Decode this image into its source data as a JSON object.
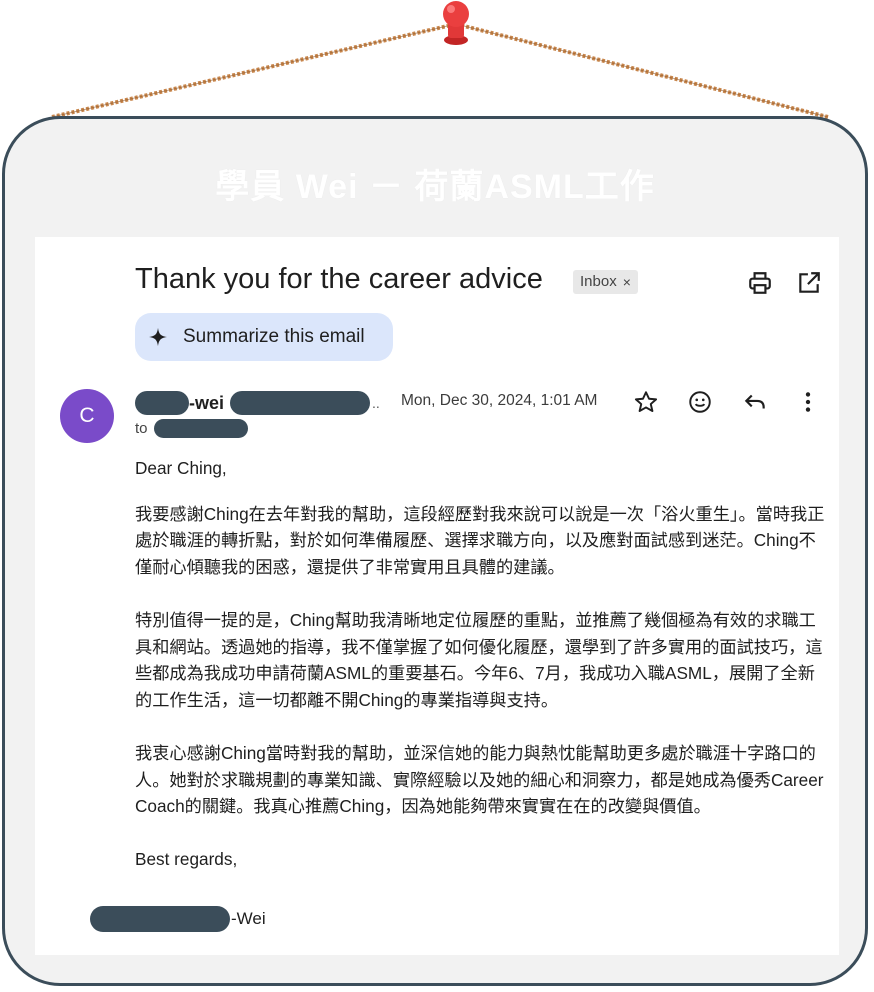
{
  "card": {
    "title": "學員 Wei － 荷蘭ASML工作"
  },
  "email": {
    "subject": "Thank you for the career advice",
    "label": "Inbox",
    "label_close": "×",
    "summarize_label": "Summarize this email",
    "avatar_letter": "C",
    "sender_visible": "-wei",
    "sender_ellipsis": "..",
    "to_prefix": "to",
    "date": "Mon, Dec 30, 2024, 1:01 AM",
    "body": {
      "greeting": "Dear Ching,",
      "para1": "我要感謝Ching在去年對我的幫助，這段經歷對我來說可以說是一次「浴火重生」。當時我正處於職涯的轉折點，對於如何準備履歷、選擇求職方向，以及應對面試感到迷茫。Ching不僅耐心傾聽我的困惑，還提供了非常實用且具體的建議。",
      "para2": "特別值得一提的是，Ching幫助我清晰地定位履歷的重點，並推薦了幾個極為有效的求職工具和網站。透過她的指導，我不僅掌握了如何優化履歷，還學到了許多實用的面試技巧，這些都成為我成功申請荷蘭ASML的重要基石。今年6、7月，我成功入職ASML，展開了全新的工作生活，這一切都離不開Ching的專業指導與支持。",
      "para3": "我衷心感謝Ching當時對我的幫助，並深信她的能力與熱忱能幫助更多處於職涯十字路口的人。她對於求職規劃的專業知識、實際經驗以及她的細心和洞察力，都是她成為優秀Career Coach的關鍵。我真心推薦Ching，因為她能夠帶來實實在在的改變與價值。",
      "closing": "Best regards,",
      "signature_suffix": "-Wei"
    }
  },
  "icons": [
    "print-icon",
    "open-in-new-window-icon",
    "sparkle-icon",
    "star-icon",
    "emoji-icon",
    "reply-icon",
    "more-vert-icon",
    "pushpin-icon"
  ],
  "colors": {
    "frame_border": "#3b4d5a",
    "frame_bg": "#f2f2f2",
    "avatar": "#7a4bc9",
    "summarize_bg": "#dbe6fb",
    "redaction": "#3b4d5a",
    "pin": "#e63a3a",
    "string": "#c8864c"
  }
}
